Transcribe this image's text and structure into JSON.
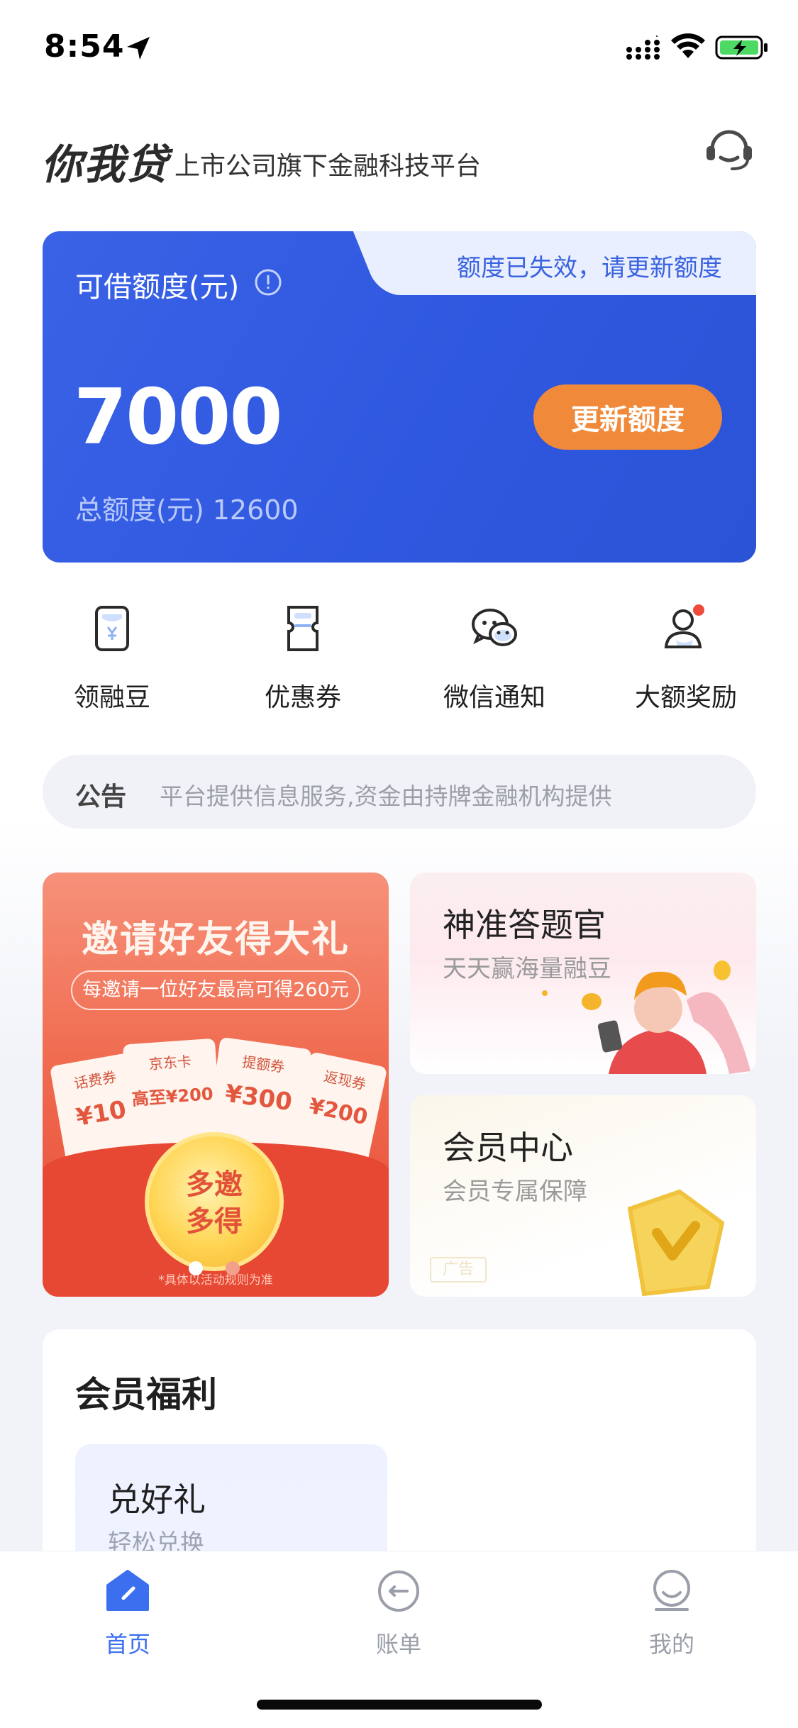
{
  "status_bar": {
    "time": "8:54"
  },
  "header": {
    "logo": "你我贷",
    "slogan": "上市公司旗下金融科技平台",
    "service_icon": "customer-service-headset-icon"
  },
  "credit_card": {
    "expired_notice": "额度已失效，请更新额度",
    "label": "可借额度(元)",
    "amount": "7000",
    "total_text": "总额度(元) 12600",
    "renew_label": "更新额度",
    "colors": {
      "card": "#2f58e0",
      "button": "#f08a3a"
    }
  },
  "quick_actions": [
    {
      "label": "领融豆",
      "icon": "bean-wallet-icon"
    },
    {
      "label": "优惠券",
      "icon": "coupon-icon"
    },
    {
      "label": "微信通知",
      "icon": "wechat-icon"
    },
    {
      "label": "大额奖励",
      "icon": "user-reward-icon"
    }
  ],
  "notice": {
    "label": "公告",
    "text": "平台提供信息服务,资金由持牌金融机构提供"
  },
  "banners": {
    "invite": {
      "title": "邀请好友得大礼",
      "subtitle": "每邀请一位好友最高可得260元",
      "tickets": [
        {
          "label": "话费券",
          "value": "¥10"
        },
        {
          "label": "京东卡",
          "value": "高至¥200"
        },
        {
          "label": "提额券",
          "value": "¥300"
        },
        {
          "label": "返现券",
          "value": "¥200"
        }
      ],
      "coin_line1": "多邀",
      "coin_line2": "多得",
      "disclaimer": "*具体以活动规则为准"
    },
    "quiz": {
      "title": "神准答题官",
      "subtitle": "天天赢海量融豆"
    },
    "member": {
      "title": "会员中心",
      "subtitle": "会员专属保障",
      "ad_tag": "广告"
    }
  },
  "benefits": {
    "title": "会员福利",
    "gift": {
      "title": "兑好礼",
      "subtitle": "轻松兑换"
    }
  },
  "tab_bar": {
    "items": [
      {
        "label": "首页",
        "active": true
      },
      {
        "label": "账单",
        "active": false
      },
      {
        "label": "我的",
        "active": false
      }
    ],
    "colors": {
      "active": "#3b6ff0",
      "inactive": "#9a9ea8"
    }
  }
}
